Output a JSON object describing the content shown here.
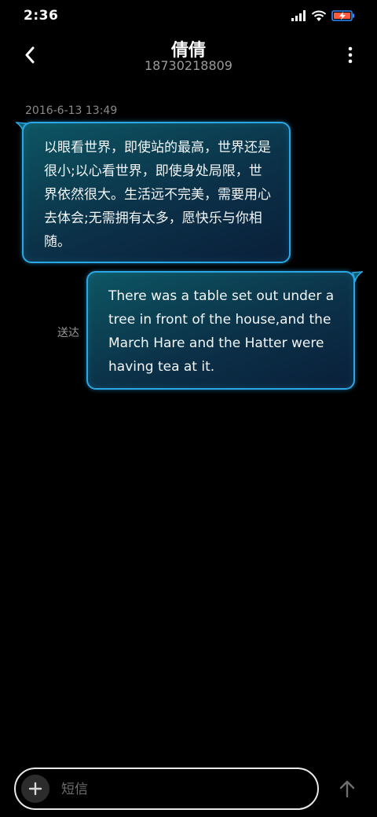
{
  "status_bar": {
    "time": "2:36",
    "icons": [
      "signal-icon",
      "wifi-icon",
      "battery-charging-icon"
    ],
    "battery_color": "#ff5a3c",
    "battery_outline": "#2f8cff"
  },
  "header": {
    "contact_name": "倩倩",
    "contact_number": "18730218809",
    "back_icon": "chevron-left-icon",
    "more_icon": "vertical-dots-icon"
  },
  "conversation": {
    "timestamp": "2016-6-13 13:49",
    "messages": [
      {
        "direction": "incoming",
        "text": "以眼看世界，即使站的最高，世界还是很小;以心看世界，即使身处局限，世界依然很大。生活远不完美，需要用心去体会;无需拥有太多，愿快乐与你相随。"
      },
      {
        "direction": "outgoing",
        "text": "There was a table set out under a tree in front of the house,and the March Hare and the Hatter were having tea at it.",
        "status": "送达"
      }
    ]
  },
  "composer": {
    "placeholder": "短信",
    "add_icon": "plus-icon",
    "send_icon": "arrow-up-icon"
  },
  "theme": {
    "bubble_border": "#2aa8e6",
    "bubble_fill_top": "#0d5663",
    "bubble_fill_bottom": "#0a1f3a",
    "background": "#000000"
  }
}
